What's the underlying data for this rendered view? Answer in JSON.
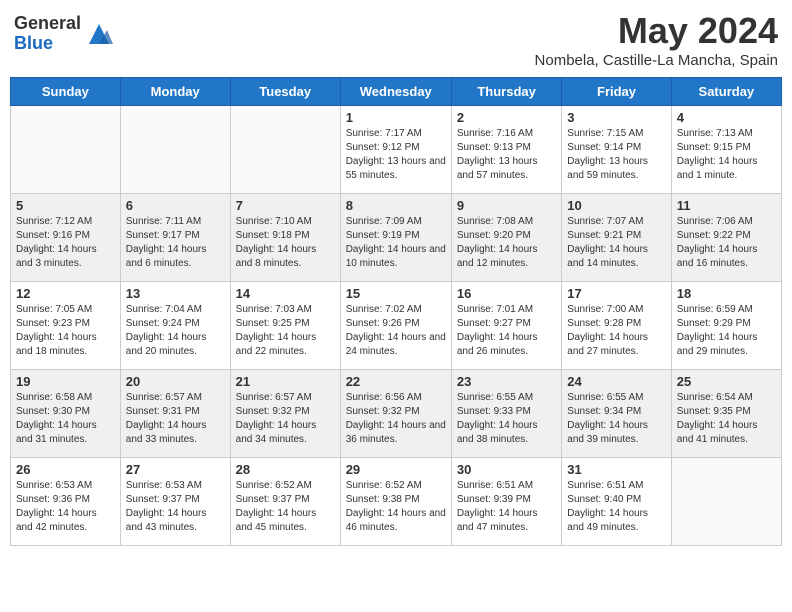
{
  "header": {
    "logo_general": "General",
    "logo_blue": "Blue",
    "month_title": "May 2024",
    "location": "Nombela, Castille-La Mancha, Spain"
  },
  "days_of_week": [
    "Sunday",
    "Monday",
    "Tuesday",
    "Wednesday",
    "Thursday",
    "Friday",
    "Saturday"
  ],
  "weeks": [
    [
      {
        "day": "",
        "info": ""
      },
      {
        "day": "",
        "info": ""
      },
      {
        "day": "",
        "info": ""
      },
      {
        "day": "1",
        "info": "Sunrise: 7:17 AM\nSunset: 9:12 PM\nDaylight: 13 hours and 55 minutes."
      },
      {
        "day": "2",
        "info": "Sunrise: 7:16 AM\nSunset: 9:13 PM\nDaylight: 13 hours and 57 minutes."
      },
      {
        "day": "3",
        "info": "Sunrise: 7:15 AM\nSunset: 9:14 PM\nDaylight: 13 hours and 59 minutes."
      },
      {
        "day": "4",
        "info": "Sunrise: 7:13 AM\nSunset: 9:15 PM\nDaylight: 14 hours and 1 minute."
      }
    ],
    [
      {
        "day": "5",
        "info": "Sunrise: 7:12 AM\nSunset: 9:16 PM\nDaylight: 14 hours and 3 minutes."
      },
      {
        "day": "6",
        "info": "Sunrise: 7:11 AM\nSunset: 9:17 PM\nDaylight: 14 hours and 6 minutes."
      },
      {
        "day": "7",
        "info": "Sunrise: 7:10 AM\nSunset: 9:18 PM\nDaylight: 14 hours and 8 minutes."
      },
      {
        "day": "8",
        "info": "Sunrise: 7:09 AM\nSunset: 9:19 PM\nDaylight: 14 hours and 10 minutes."
      },
      {
        "day": "9",
        "info": "Sunrise: 7:08 AM\nSunset: 9:20 PM\nDaylight: 14 hours and 12 minutes."
      },
      {
        "day": "10",
        "info": "Sunrise: 7:07 AM\nSunset: 9:21 PM\nDaylight: 14 hours and 14 minutes."
      },
      {
        "day": "11",
        "info": "Sunrise: 7:06 AM\nSunset: 9:22 PM\nDaylight: 14 hours and 16 minutes."
      }
    ],
    [
      {
        "day": "12",
        "info": "Sunrise: 7:05 AM\nSunset: 9:23 PM\nDaylight: 14 hours and 18 minutes."
      },
      {
        "day": "13",
        "info": "Sunrise: 7:04 AM\nSunset: 9:24 PM\nDaylight: 14 hours and 20 minutes."
      },
      {
        "day": "14",
        "info": "Sunrise: 7:03 AM\nSunset: 9:25 PM\nDaylight: 14 hours and 22 minutes."
      },
      {
        "day": "15",
        "info": "Sunrise: 7:02 AM\nSunset: 9:26 PM\nDaylight: 14 hours and 24 minutes."
      },
      {
        "day": "16",
        "info": "Sunrise: 7:01 AM\nSunset: 9:27 PM\nDaylight: 14 hours and 26 minutes."
      },
      {
        "day": "17",
        "info": "Sunrise: 7:00 AM\nSunset: 9:28 PM\nDaylight: 14 hours and 27 minutes."
      },
      {
        "day": "18",
        "info": "Sunrise: 6:59 AM\nSunset: 9:29 PM\nDaylight: 14 hours and 29 minutes."
      }
    ],
    [
      {
        "day": "19",
        "info": "Sunrise: 6:58 AM\nSunset: 9:30 PM\nDaylight: 14 hours and 31 minutes."
      },
      {
        "day": "20",
        "info": "Sunrise: 6:57 AM\nSunset: 9:31 PM\nDaylight: 14 hours and 33 minutes."
      },
      {
        "day": "21",
        "info": "Sunrise: 6:57 AM\nSunset: 9:32 PM\nDaylight: 14 hours and 34 minutes."
      },
      {
        "day": "22",
        "info": "Sunrise: 6:56 AM\nSunset: 9:32 PM\nDaylight: 14 hours and 36 minutes."
      },
      {
        "day": "23",
        "info": "Sunrise: 6:55 AM\nSunset: 9:33 PM\nDaylight: 14 hours and 38 minutes."
      },
      {
        "day": "24",
        "info": "Sunrise: 6:55 AM\nSunset: 9:34 PM\nDaylight: 14 hours and 39 minutes."
      },
      {
        "day": "25",
        "info": "Sunrise: 6:54 AM\nSunset: 9:35 PM\nDaylight: 14 hours and 41 minutes."
      }
    ],
    [
      {
        "day": "26",
        "info": "Sunrise: 6:53 AM\nSunset: 9:36 PM\nDaylight: 14 hours and 42 minutes."
      },
      {
        "day": "27",
        "info": "Sunrise: 6:53 AM\nSunset: 9:37 PM\nDaylight: 14 hours and 43 minutes."
      },
      {
        "day": "28",
        "info": "Sunrise: 6:52 AM\nSunset: 9:37 PM\nDaylight: 14 hours and 45 minutes."
      },
      {
        "day": "29",
        "info": "Sunrise: 6:52 AM\nSunset: 9:38 PM\nDaylight: 14 hours and 46 minutes."
      },
      {
        "day": "30",
        "info": "Sunrise: 6:51 AM\nSunset: 9:39 PM\nDaylight: 14 hours and 47 minutes."
      },
      {
        "day": "31",
        "info": "Sunrise: 6:51 AM\nSunset: 9:40 PM\nDaylight: 14 hours and 49 minutes."
      },
      {
        "day": "",
        "info": ""
      }
    ]
  ]
}
